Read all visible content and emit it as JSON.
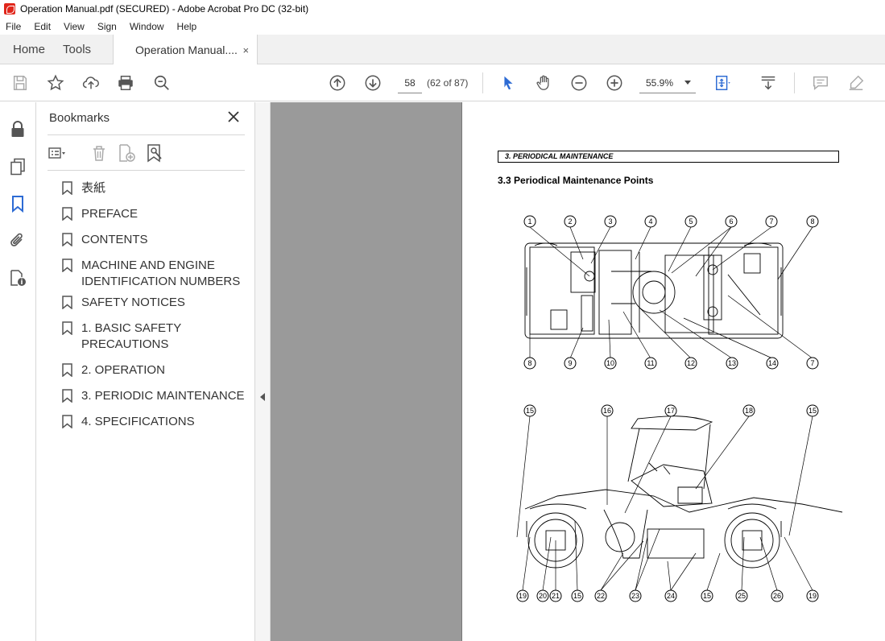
{
  "window": {
    "title": "Operation Manual.pdf (SECURED) - Adobe Acrobat Pro DC (32-bit)"
  },
  "menu": [
    "File",
    "Edit",
    "View",
    "Sign",
    "Window",
    "Help"
  ],
  "tabs": {
    "home": "Home",
    "tools": "Tools",
    "document": "Operation Manual....",
    "close": "×"
  },
  "toolbar": {
    "page_input": "58",
    "page_count": "(62 of 87)",
    "zoom": "55.9%"
  },
  "bookmarks": {
    "title": "Bookmarks",
    "items": [
      {
        "label": "表紙"
      },
      {
        "label": "PREFACE"
      },
      {
        "label": "CONTENTS"
      },
      {
        "label": "MACHINE AND ENGINE IDENTIFICATION NUMBERS"
      },
      {
        "label": "SAFETY NOTICES"
      },
      {
        "label": "1. BASIC SAFETY PRECAUTIONS"
      },
      {
        "label": "2. OPERATION"
      },
      {
        "label": "3. PERIODIC MAINTENANCE"
      },
      {
        "label": "4. SPECIFICATIONS"
      }
    ]
  },
  "document": {
    "section_header": "3.  PERIODICAL MAINTENANCE",
    "subheading": "3.3  Periodical Maintenance Points",
    "top_callouts_upper": [
      "1",
      "2",
      "3",
      "4",
      "5",
      "6",
      "7",
      "8"
    ],
    "top_callouts_lower": [
      "8",
      "9",
      "10",
      "11",
      "12",
      "13",
      "14",
      "7"
    ],
    "side_callouts_upper": [
      "15",
      "16",
      "17",
      "18",
      "15"
    ],
    "side_callouts_lower": [
      "19",
      "20",
      "21",
      "15",
      "22",
      "23",
      "24",
      "15",
      "25",
      "26",
      "19"
    ]
  }
}
